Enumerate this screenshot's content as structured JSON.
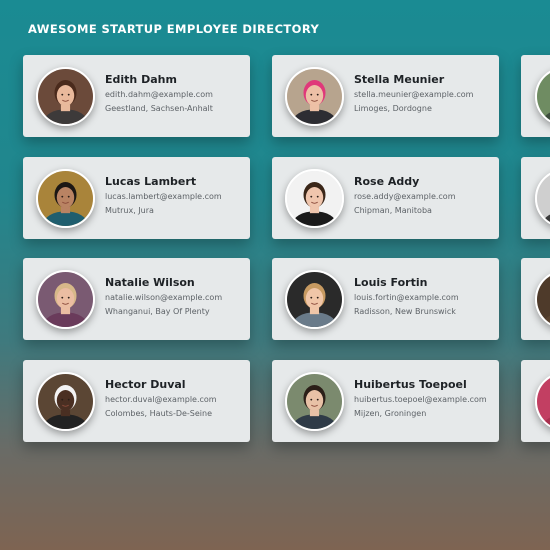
{
  "header": {
    "title": "AWESOME STARTUP EMPLOYEE DIRECTORY"
  },
  "employees": [
    {
      "name": "Edith Dahm",
      "email": "edith.dahm@example.com",
      "location": "Geestland, Sachsen-Anhalt",
      "avatar": "avatar-woman-brown-hair",
      "bg": "#6b4a3a",
      "hair": "#4a2a1c",
      "skin": "#e9b99c",
      "shirt": "#3d3a3a"
    },
    {
      "name": "Stella Meunier",
      "email": "stella.meunier@example.com",
      "location": "Limoges, Dordogne",
      "avatar": "avatar-woman-pink-hair",
      "bg": "#b7a48e",
      "hair": "#e0387a",
      "skin": "#edc0a6",
      "shirt": "#2d2d33"
    },
    {
      "name": "Lucas Lambert",
      "email": "lucas.lambert@example.com",
      "location": "Mutrux, Jura",
      "avatar": "avatar-man-smiling",
      "bg": "#a9843a",
      "hair": "#1c1714",
      "skin": "#b98363",
      "shirt": "#1f5e6e"
    },
    {
      "name": "Rose Addy",
      "email": "rose.addy@example.com",
      "location": "Chipman, Manitoba",
      "avatar": "avatar-woman-dark-hair",
      "bg": "#f2f2f2",
      "hair": "#3a2618",
      "skin": "#efc5ad",
      "shirt": "#1a1a1a"
    },
    {
      "name": "Natalie Wilson",
      "email": "natalie.wilson@example.com",
      "location": "Whanganui, Bay Of Plenty",
      "avatar": "avatar-woman-blonde",
      "bg": "#7a5a72",
      "hair": "#d7b889",
      "skin": "#ebbda2",
      "shirt": "#6a3b5b"
    },
    {
      "name": "Louis Fortin",
      "email": "louis.fortin@example.com",
      "location": "Radisson, New Brunswick",
      "avatar": "avatar-man-light-hair",
      "bg": "#2a2a2a",
      "hair": "#c79a61",
      "skin": "#f0c6a8",
      "shirt": "#6a7b8a"
    },
    {
      "name": "Hector Duval",
      "email": "hector.duval@example.com",
      "location": "Colombes, Hauts-De-Seine",
      "avatar": "avatar-man-cap",
      "bg": "#5b4634",
      "hair": "#f3f3f3",
      "skin": "#4a2f22",
      "shirt": "#222222"
    },
    {
      "name": "Huibertus Toepoel",
      "email": "huibertus.toepoel@example.com",
      "location": "Mijzen, Groningen",
      "avatar": "avatar-man-dark-hair",
      "bg": "#7b8a6e",
      "hair": "#2b1f18",
      "skin": "#e8c1a6",
      "shirt": "#2f3b47"
    }
  ],
  "partial_cards": [
    {
      "avatar": "avatar-partial-1",
      "bg": "#6f8c62",
      "hair": "#4a5a3a",
      "skin": "#d9b497",
      "shirt": "#3d4c3d"
    },
    {
      "avatar": "avatar-partial-2",
      "bg": "#cfcfcf",
      "hair": "#2a2a2a",
      "skin": "#e2bca1",
      "shirt": "#3a3a3a"
    },
    {
      "avatar": "avatar-partial-3",
      "bg": "#4e3a2a",
      "hair": "#2a1d14",
      "skin": "#d9a882",
      "shirt": "#5a4330"
    },
    {
      "avatar": "avatar-partial-4",
      "bg": "#c23f62",
      "hair": "#6a2a1c",
      "skin": "#f0c2a6",
      "shirt": "#a8314f"
    }
  ]
}
